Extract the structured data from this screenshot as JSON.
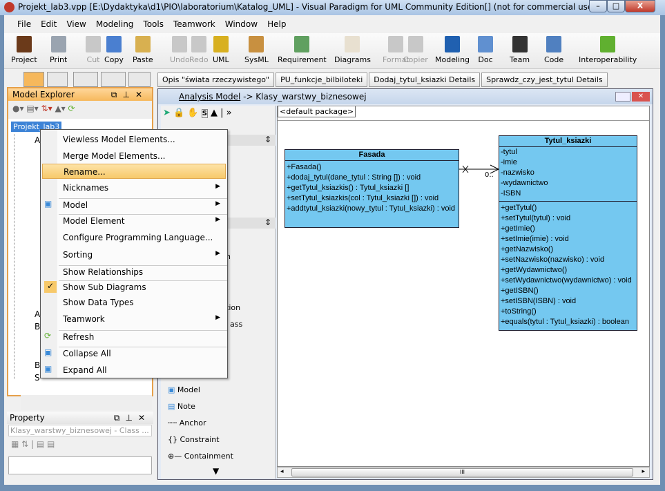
{
  "window": {
    "title": "Projekt_lab3.vpp [E:\\Dydaktyka\\d1\\PIO\\laboratorium\\Katalog_UML] - Visual Paradigm for UML Community Edition[] (not for commercial use)",
    "minimize": "–",
    "maximize": "□",
    "close": "X"
  },
  "menu": [
    "File",
    "Edit",
    "View",
    "Modeling",
    "Tools",
    "Teamwork",
    "Window",
    "Help"
  ],
  "toolbar": [
    {
      "label": "Project",
      "color": "#6b3a1a",
      "enabled": true
    },
    {
      "label": "Print",
      "color": "#9aa4b0",
      "enabled": true
    },
    {
      "label": "Cut",
      "color": "#c8c8c8",
      "enabled": false
    },
    {
      "label": "Copy",
      "color": "#4a7fd0",
      "enabled": true
    },
    {
      "label": "Paste",
      "color": "#d8b050",
      "enabled": true
    },
    {
      "label": "Undo",
      "color": "#c8c8c8",
      "enabled": false
    },
    {
      "label": "Redo",
      "color": "#c8c8c8",
      "enabled": false
    },
    {
      "label": "UML",
      "color": "#d8b020",
      "enabled": true
    },
    {
      "label": "SysML",
      "color": "#c89040",
      "enabled": true
    },
    {
      "label": "Requirement",
      "color": "#60a060",
      "enabled": true
    },
    {
      "label": "Diagrams",
      "color": "#e8e0d0",
      "enabled": true
    },
    {
      "label": "Format",
      "color": "#c8c8c8",
      "enabled": false
    },
    {
      "label": "Copier",
      "color": "#c8c8c8",
      "enabled": false
    },
    {
      "label": "Modeling",
      "color": "#2060b0",
      "enabled": true
    },
    {
      "label": "Doc",
      "color": "#6090d0",
      "enabled": true
    },
    {
      "label": "Team",
      "color": "#333333",
      "enabled": true
    },
    {
      "label": "Code",
      "color": "#5080c0",
      "enabled": true
    },
    {
      "label": "Interoperability",
      "color": "#60b030",
      "enabled": true
    }
  ],
  "doc_tabs": [
    "Opis \"świata rzeczywistego\"",
    "PU_funkcje_bilbiloteki",
    "Dodaj_tytul_ksiazki Details",
    "Sprawdz_czy_jest_tytul Details"
  ],
  "model_explorer": {
    "title": "Model Explorer",
    "root": "Projekt_lab3",
    "partial_items": [
      "A",
      "A",
      "B",
      "B",
      "S"
    ]
  },
  "context_menu": [
    {
      "label": "Viewless Model Elements...",
      "submenu": false
    },
    {
      "label": "Merge Model Elements...",
      "submenu": false
    },
    {
      "label": "Rename...",
      "submenu": false,
      "highlighted": true
    },
    {
      "label": "Nicknames",
      "submenu": true
    },
    {
      "label": "Model",
      "submenu": true,
      "icon": "model-icon"
    },
    {
      "label": "Model Element",
      "submenu": true
    },
    {
      "label": "Configure Programming Language...",
      "submenu": false
    },
    {
      "label": "Sorting",
      "submenu": true
    },
    {
      "label": "Show Relationships",
      "submenu": false
    },
    {
      "label": "Show Sub Diagrams",
      "submenu": false,
      "checked": true
    },
    {
      "label": "Show Data Types",
      "submenu": false
    },
    {
      "label": "Teamwork",
      "submenu": true
    },
    {
      "label": "Refresh",
      "submenu": false,
      "icon": "refresh-icon"
    },
    {
      "label": "Collapse All",
      "submenu": false,
      "icon": "collapse-all-icon"
    },
    {
      "label": "Expand All",
      "submenu": false,
      "icon": "expand-all-icon"
    }
  ],
  "property": {
    "title": "Property",
    "selector": "Klasy_warstwy_biznesowej - Class ..."
  },
  "diagram": {
    "breadcrumb_link": "Analysis Model",
    "breadcrumb_rest": " -> Klasy_warstwy_biznesowej",
    "package_tab": "<default package>",
    "palette_partial": [
      "n",
      "tion",
      "ass"
    ],
    "palette_items": [
      "Model",
      "Note",
      "Anchor",
      "Constraint",
      "Containment"
    ],
    "scroll_grip": "III"
  },
  "classes": [
    {
      "name": "Fasada",
      "attributes": [],
      "operations": [
        "+Fasada()",
        "+dodaj_tytul(dane_tytul : String []) : void",
        "+getTytul_ksiazkis() : Tytul_ksiazki []",
        "+setTytul_ksiazkis(col : Tytul_ksiazki []) : void",
        "+addtytul_ksiazki(nowy_tytul : Tytul_ksiazki) : void"
      ]
    },
    {
      "name": "Tytul_ksiazki",
      "attributes": [
        "-tytul",
        "-imie",
        "-nazwisko",
        "-wydawnictwo",
        "-ISBN"
      ],
      "operations": [
        "+getTytul()",
        "+setTytul(tytul) : void",
        "+getImie()",
        "+setImie(imie) : void",
        "+getNazwisko()",
        "+setNazwisko(nazwisko) : void",
        "+getWydawnictwo()",
        "+setWydawnictwo(wydawnictwo) : void",
        "+getISBN()",
        "+setISBN(ISBN) : void",
        "+toString()",
        "+equals(tytul : Tytul_ksiazki) : boolean"
      ]
    }
  ],
  "association": {
    "multiplicity": "0.."
  },
  "colors": {
    "class_fill": "#74c8f0",
    "highlight": "#f7c96a",
    "panel_border": "#e6a04a"
  }
}
